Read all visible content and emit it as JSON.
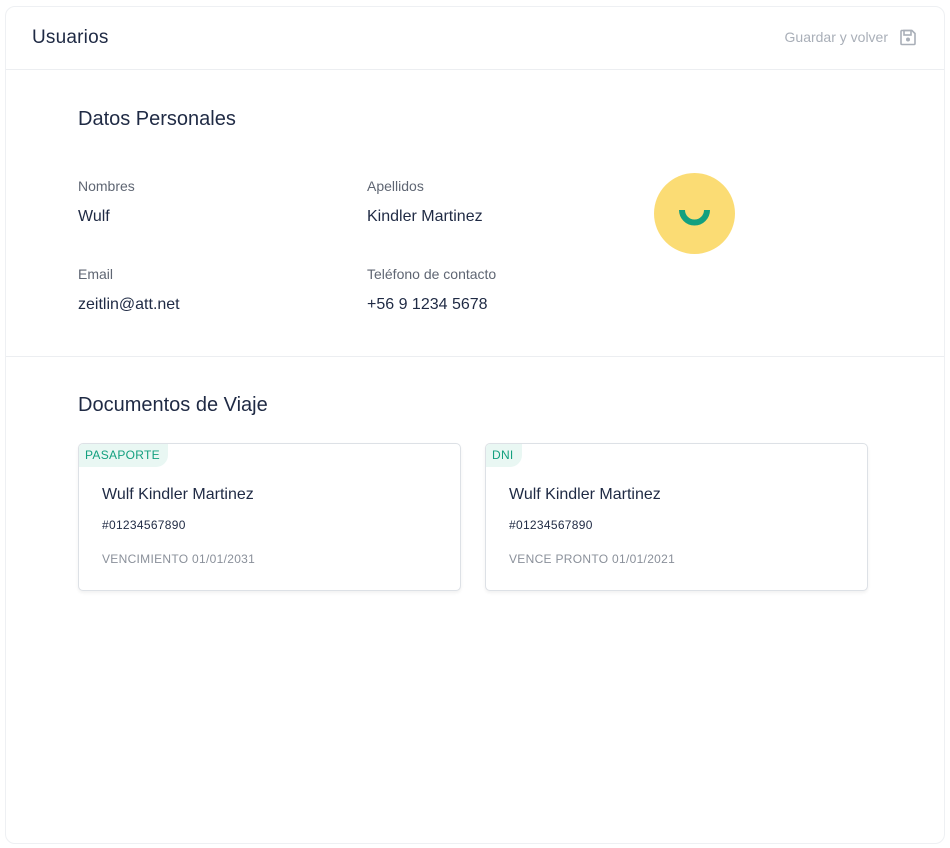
{
  "header": {
    "title": "Usuarios",
    "save_label": "Guardar y volver",
    "save_icon": "floppy-disk-icon"
  },
  "personal": {
    "section_title": "Datos Personales",
    "first_name": {
      "label": "Nombres",
      "value": "Wulf"
    },
    "last_name": {
      "label": "Apellidos",
      "value": "Kindler Martinez"
    },
    "email": {
      "label": "Email",
      "value": "zeitlin@att.net"
    },
    "phone": {
      "label": "Teléfono de contacto",
      "value": "+56 9 1234 5678"
    },
    "avatar": {
      "icon": "smile-icon",
      "background": "#fbdc74",
      "accent": "#13a07f"
    }
  },
  "documents": {
    "section_title": "Documentos de Viaje",
    "cards": [
      {
        "tag": "PASAPORTE",
        "name": "Wulf Kindler Martinez",
        "number": "#01234567890",
        "expiry": "VENCIMIENTO 01/01/2031"
      },
      {
        "tag": "DNI",
        "name": "Wulf Kindler Martinez",
        "number": "#01234567890",
        "expiry": "VENCE PRONTO 01/01/2021"
      }
    ]
  },
  "colors": {
    "text_primary": "#1f2a44",
    "text_muted": "#a9afb8",
    "tag_background": "#e9f7f3",
    "tag_text": "#13a07f"
  }
}
